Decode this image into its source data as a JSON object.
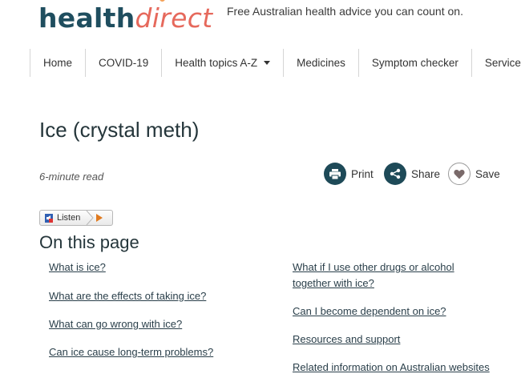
{
  "header": {
    "logo_part1": "health",
    "logo_part2": "direct",
    "tagline": "Free Australian health advice you can count on."
  },
  "nav": {
    "items": [
      {
        "label": "Home"
      },
      {
        "label": "COVID-19"
      },
      {
        "label": "Health topics A-Z"
      },
      {
        "label": "Medicines"
      },
      {
        "label": "Symptom checker"
      },
      {
        "label": "Service fir"
      }
    ]
  },
  "article": {
    "title": "Ice (crystal meth)",
    "read_time": "6-minute read",
    "actions": {
      "print": "Print",
      "share": "Share",
      "save": "Save"
    },
    "listen_label": "Listen"
  },
  "toc": {
    "heading": "On this page",
    "left": [
      "What is ice?",
      "What are the effects of taking ice?",
      "What can go wrong with ice?",
      "Can ice cause long-term problems?"
    ],
    "right": [
      "What if I use other drugs or alcohol",
      "together with ice?",
      "Can I become dependent on ice?",
      "Resources and support",
      "Related information on Australian websites"
    ]
  },
  "colors": {
    "brand_dark": "#1f4e5f",
    "brand_accent": "#e6695c",
    "button_dark": "#1e4a58"
  }
}
